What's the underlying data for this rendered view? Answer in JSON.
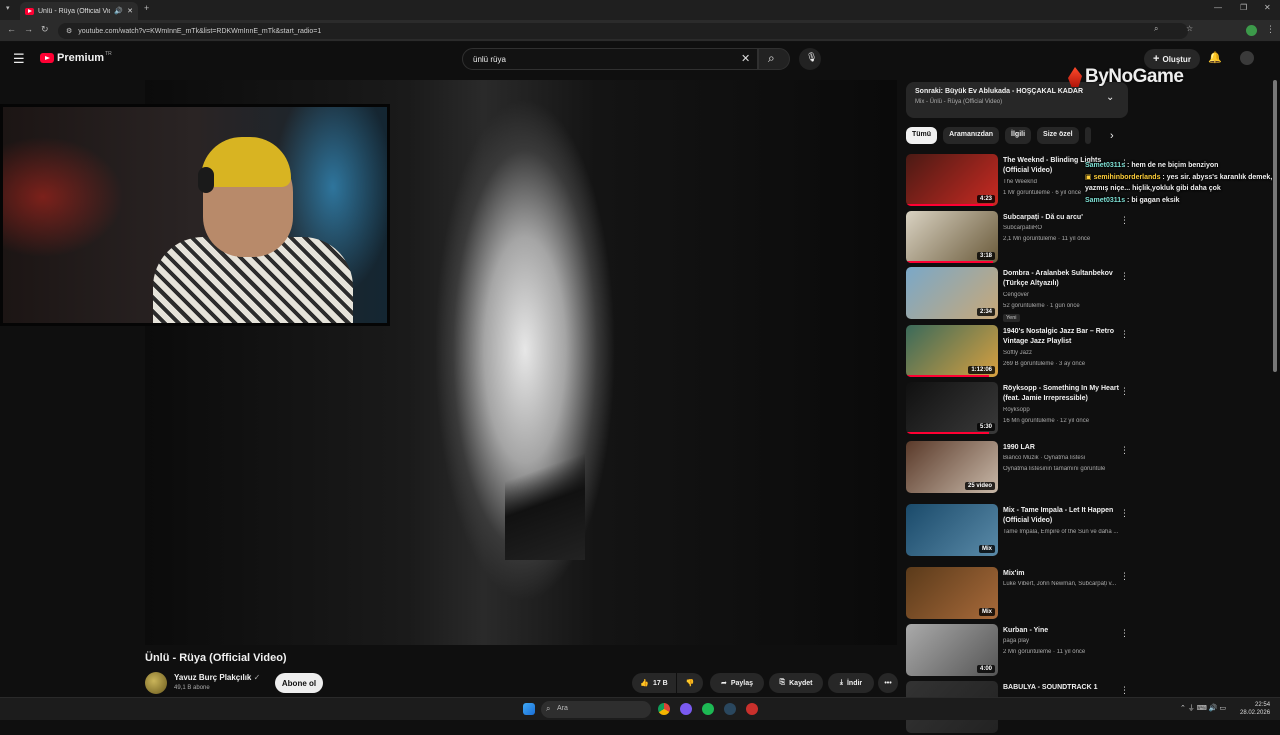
{
  "browser": {
    "tab_title": "Ünlü - Rüya (Official Video)",
    "url": "youtube.com/watch?v=KWmInnE_mTk&list=RDKWmInnE_mTk&start_radio=1"
  },
  "header": {
    "logo_text": "Premium",
    "region": "TR",
    "search_value": "ünlü rüya",
    "create_label": "Oluştur"
  },
  "video": {
    "title": "Ünlü - Rüya (Official Video)",
    "channel": "Yavuz Burç Plakçılık",
    "subscribers": "49,1 B abone",
    "subscribe_label": "Abone ol",
    "likes": "17 B",
    "share_label": "Paylaş",
    "save_label": "Kaydet",
    "download_label": "İndir"
  },
  "sidebar": {
    "next_title": "Sonraki: Büyük Ev Ablukada - HOŞÇAKAL KADAR",
    "next_sub": "Mix - Ünlü - Rüya (Official Video)",
    "chips": [
      "Tümü",
      "Aramanızdan",
      "İlgili",
      "Size özel"
    ],
    "items": [
      {
        "title": "The Weeknd - Blinding Lights (Official Video)",
        "channel": "The Weeknd",
        "meta": "1 Mr görüntüleme · 6 yıl önce",
        "duration": "4:23",
        "thumb1": "#4a1a14",
        "thumb2": "#c92a22",
        "progress": 0.95
      },
      {
        "title": "Subcarpați - Dă cu arcu'",
        "channel": "SubcarpatiiRO",
        "meta": "2,1 Mn görüntüleme · 11 yıl önce",
        "duration": "3:18",
        "thumb1": "#d9d2c2",
        "thumb2": "#6a5a3a",
        "progress": 0.95
      },
      {
        "title": "Dombra - Aralanbek Sultanbekov (Türkçe Altyazılı)",
        "channel": "Cengover",
        "meta": "52 görüntüleme · 1 gün önce",
        "badge": "Yeni",
        "duration": "2:34",
        "thumb1": "#7aa8c8",
        "thumb2": "#c8a878",
        "progress": 0
      },
      {
        "title": "1940's Nostalgic Jazz Bar – Retro Vintage Jazz Playlist",
        "channel": "Softly Jazz",
        "meta": "269 B görüntüleme · 3 ay önce",
        "duration": "1:12:06",
        "thumb1": "#3a6a5a",
        "thumb2": "#d8a040",
        "progress": 0.9
      },
      {
        "title": "Röyksopp - Something In My Heart (feat. Jamie Irrepressible)",
        "channel": "Röyksopp",
        "meta": "16 Mn görüntüleme · 12 yıl önce",
        "duration": "5:30",
        "thumb1": "#101010",
        "thumb2": "#3a3a3a",
        "progress": 0.9
      },
      {
        "title": "1990 LAR",
        "channel": "Bianco Müzik · Oynatma listesi",
        "meta": "Oynatma listesinin tamamını görüntüle",
        "duration": "25 video",
        "thumb1": "#5a3a2a",
        "thumb2": "#c8b8a8",
        "progress": 0
      },
      {
        "title": "Mix - Tame Impala - Let It Happen (Official Video)",
        "channel": "Tame Impala, Empire of the Sun ve daha ...",
        "meta": "",
        "duration": "Mix",
        "thumb1": "#1a4a6a",
        "thumb2": "#5a8aa8",
        "progress": 0
      },
      {
        "title": "Mix'im",
        "channel": "Luke Vibert, John Newman, Subcarpați v...",
        "meta": "",
        "duration": "Mix",
        "thumb1": "#5a3a1a",
        "thumb2": "#a86a3a",
        "progress": 0
      },
      {
        "title": "Kurban - Yine",
        "channel": "paga play",
        "meta": "2 Mn görüntüleme · 11 yıl önce",
        "duration": "4:00",
        "thumb1": "#aaaaaa",
        "thumb2": "#555555",
        "progress": 0
      },
      {
        "title": "BABULYA - SOUNDTRACK 1",
        "channel": "",
        "meta": "",
        "duration": "",
        "thumb1": "#333",
        "thumb2": "#222",
        "progress": 0
      }
    ]
  },
  "overlay": {
    "brand": "ByNoGame",
    "chat": [
      {
        "user": "Samet0311s",
        "text": " : hem de ne biçim benziyon"
      },
      {
        "user": "semihinborderlands",
        "text": " : yes sir. abyss's karanlık demek, yazmış niçe... hiçlik,yokluk gibi daha çok"
      },
      {
        "user": "Samet0311s",
        "text": " : bi gagan eksik"
      }
    ]
  },
  "taskbar": {
    "search_placeholder": "Ara",
    "time": "22:54",
    "date": "28.02.2026"
  },
  "colors": {
    "accent": "#ff0033",
    "bg": "#0f0f0f",
    "surface": "#272727"
  }
}
